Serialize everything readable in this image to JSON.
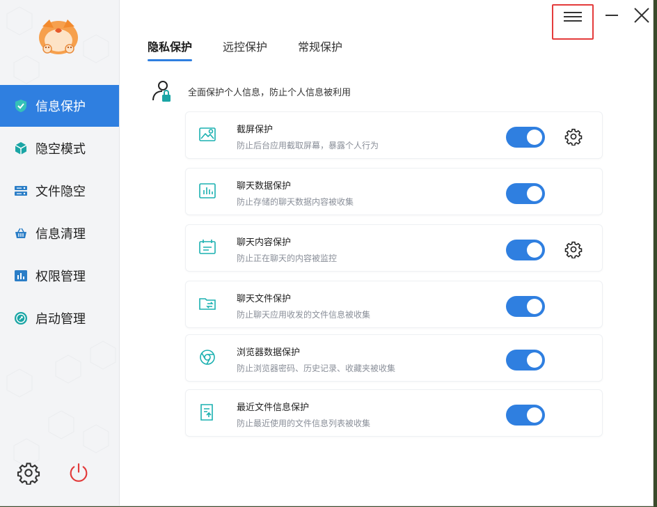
{
  "sidebar": {
    "items": [
      {
        "label": "信息保护",
        "icon": "shield-check-icon",
        "active": true
      },
      {
        "label": "隐空模式",
        "icon": "cube-icon",
        "active": false
      },
      {
        "label": "文件隐空",
        "icon": "server-icon",
        "active": false
      },
      {
        "label": "信息清理",
        "icon": "basket-icon",
        "active": false
      },
      {
        "label": "权限管理",
        "icon": "chart-bars-icon",
        "active": false
      },
      {
        "label": "启动管理",
        "icon": "rocket-circle-icon",
        "active": false
      }
    ],
    "bottom": [
      "gear-icon",
      "power-icon"
    ]
  },
  "tabs": [
    {
      "label": "隐私保护",
      "active": true
    },
    {
      "label": "远控保护",
      "active": false
    },
    {
      "label": "常规保护",
      "active": false
    }
  ],
  "section": {
    "description": "全面保护个人信息，防止个人信息被利用"
  },
  "cards": [
    {
      "title": "截屏保护",
      "desc": "防止后台应用截取屏幕，暴露个人行为",
      "icon": "screenshot-image-icon",
      "enabled": true,
      "has_settings": true
    },
    {
      "title": "聊天数据保护",
      "desc": "防止存储的聊天数据内容被收集",
      "icon": "chat-chart-icon",
      "enabled": true,
      "has_settings": false
    },
    {
      "title": "聊天内容保护",
      "desc": "防止正在聊天的内容被监控",
      "icon": "chat-calendar-icon",
      "enabled": true,
      "has_settings": true
    },
    {
      "title": "聊天文件保护",
      "desc": "防止聊天应用收发的文件信息被收集",
      "icon": "folder-transfer-icon",
      "enabled": true,
      "has_settings": false
    },
    {
      "title": "浏览器数据保护",
      "desc": "防止浏览器密码、历史记录、收藏夹被收集",
      "icon": "browser-icon",
      "enabled": true,
      "has_settings": false
    },
    {
      "title": "最近文件信息保护",
      "desc": "防止最近使用的文件信息列表被收集",
      "icon": "recent-file-icon",
      "enabled": true,
      "has_settings": false
    }
  ],
  "colors": {
    "accent": "#2f7fe0",
    "icon_teal": "#1ab0b0",
    "highlight": "#e43b3b"
  }
}
